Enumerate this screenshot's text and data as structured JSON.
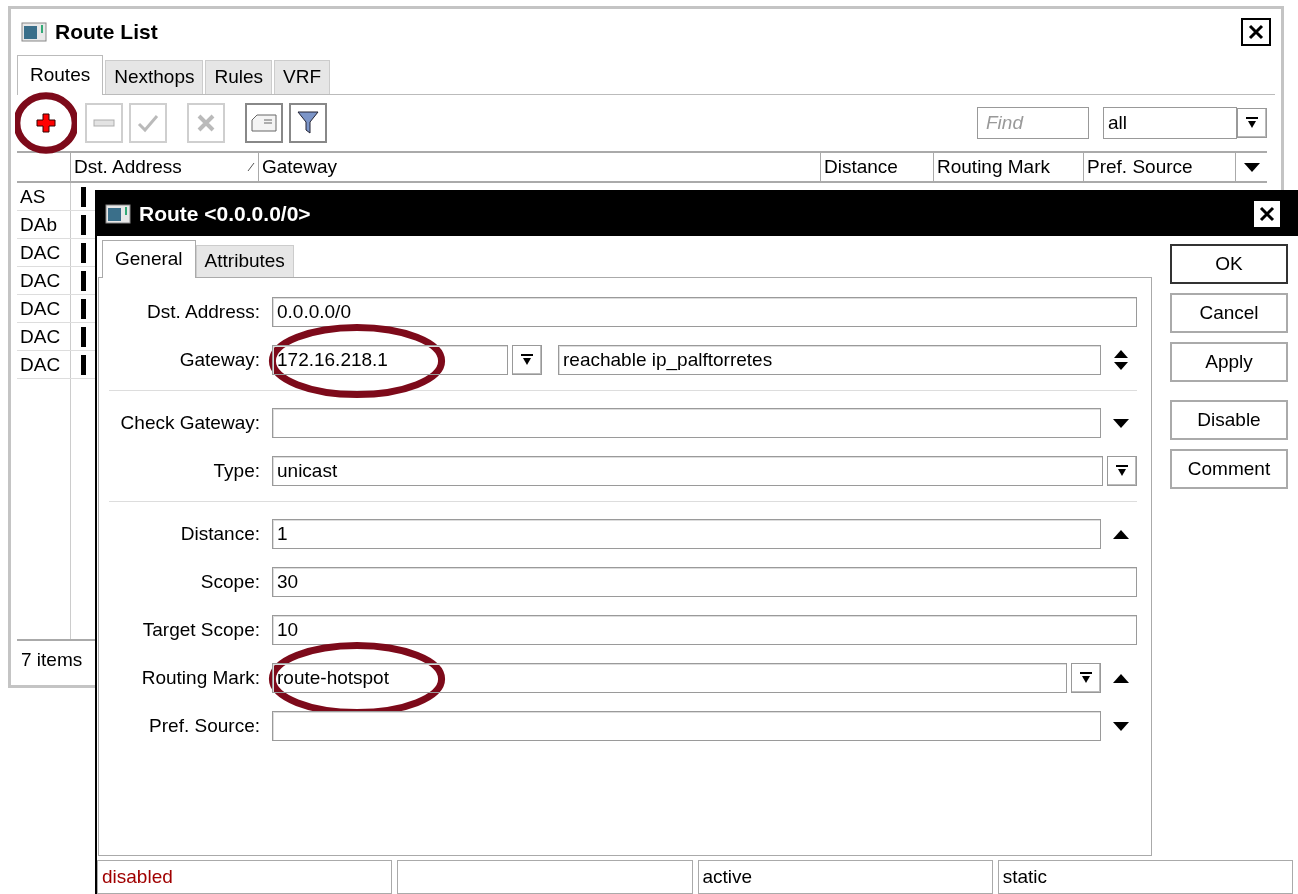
{
  "route_list": {
    "title": "Route List",
    "tabs": [
      {
        "label": "Routes",
        "selected": true
      },
      {
        "label": "Nexthops",
        "selected": false
      },
      {
        "label": "Rules",
        "selected": false
      },
      {
        "label": "VRF",
        "selected": false
      }
    ],
    "toolbar": [
      {
        "kind": "add",
        "disabled": false,
        "highlighted": true
      },
      {
        "kind": "remove",
        "disabled": true,
        "highlighted": false
      },
      {
        "kind": "enable",
        "disabled": true,
        "highlighted": false
      },
      {
        "kind": "disable",
        "disabled": true,
        "highlighted": false
      },
      {
        "kind": "comment",
        "disabled": false,
        "highlighted": false
      },
      {
        "kind": "filter",
        "disabled": false,
        "highlighted": false
      }
    ],
    "find": {
      "placeholder": "Find"
    },
    "filter": {
      "value": "all"
    },
    "columns": [
      {
        "label": "Dst. Address",
        "sorted": true
      },
      {
        "label": "Gateway",
        "sorted": false
      },
      {
        "label": "Distance",
        "sorted": false
      },
      {
        "label": "Routing Mark",
        "sorted": false
      },
      {
        "label": "Pref. Source",
        "sorted": false
      }
    ],
    "rows": [
      {
        "flags": "AS"
      },
      {
        "flags": "DAb"
      },
      {
        "flags": "DAC"
      },
      {
        "flags": "DAC"
      },
      {
        "flags": "DAC"
      },
      {
        "flags": "DAC"
      },
      {
        "flags": "DAC"
      }
    ],
    "status": "7 items"
  },
  "route_dialog": {
    "title": "Route <0.0.0.0/0>",
    "tabs": [
      {
        "label": "General",
        "selected": true
      },
      {
        "label": "Attributes",
        "selected": false
      }
    ],
    "field_groups": [
      [
        {
          "label": "Dst. Address:",
          "value": "0.0.0.0/0",
          "dropdown": false,
          "spinner_up": false,
          "spinner_down": false,
          "highlighted": false
        },
        {
          "label": "Gateway:",
          "value": "172.16.218.1",
          "dropdown": true,
          "extra": "reachable ip_palftorretes",
          "spinner_up": true,
          "spinner_down": true,
          "highlighted": true
        }
      ],
      [
        {
          "label": "Check Gateway:",
          "dropdown": false,
          "spinner_up": false,
          "spinner_down": true,
          "highlighted": false
        },
        {
          "label": "Type:",
          "value": "unicast",
          "dropdown": true,
          "spinner_up": false,
          "spinner_down": false,
          "highlighted": false
        }
      ],
      [
        {
          "label": "Distance:",
          "value": "1",
          "dropdown": false,
          "spinner_up": true,
          "spinner_down": false,
          "highlighted": false
        },
        {
          "label": "Scope:",
          "value": "30",
          "dropdown": false,
          "spinner_up": false,
          "spinner_down": false,
          "highlighted": false
        },
        {
          "label": "Target Scope:",
          "value": "10",
          "dropdown": false,
          "spinner_up": false,
          "spinner_down": false,
          "highlighted": false
        },
        {
          "label": "Routing Mark:",
          "value": "route-hotspot",
          "dropdown": true,
          "spinner_up": true,
          "spinner_down": false,
          "highlighted": true
        },
        {
          "label": "Pref. Source:",
          "dropdown": false,
          "spinner_up": false,
          "spinner_down": true,
          "highlighted": false
        }
      ]
    ],
    "button_groups": [
      [
        {
          "label": "OK",
          "default": true
        },
        {
          "label": "Cancel",
          "default": false
        },
        {
          "label": "Apply",
          "default": false
        }
      ],
      [
        {
          "label": "Disable",
          "default": false
        },
        {
          "label": "Comment",
          "default": false
        }
      ]
    ],
    "status_bar": [
      {
        "text": "disabled",
        "kind": "alert"
      },
      {
        "kind": "normal"
      },
      {
        "text": "active",
        "kind": "normal"
      },
      {
        "text": "static",
        "kind": "normal"
      }
    ]
  }
}
